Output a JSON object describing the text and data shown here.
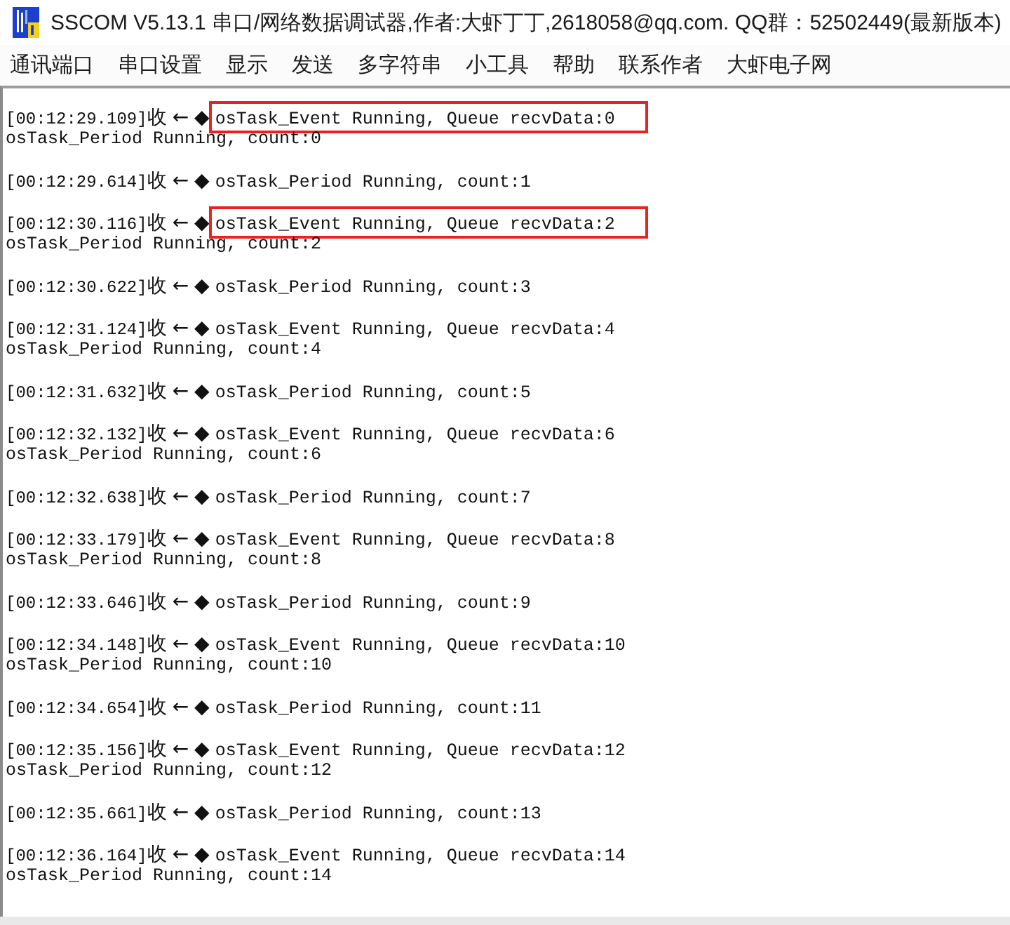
{
  "window": {
    "title": "SSCOM V5.13.1 串口/网络数据调试器,作者:大虾丁丁,2618058@qq.com. QQ群：52502449(最新版本)"
  },
  "menu": [
    "通讯端口",
    "串口设置",
    "显示",
    "发送",
    "多字符串",
    "小工具",
    "帮助",
    "联系作者",
    "大虾电子网"
  ],
  "receive_log": {
    "entries": [
      {
        "timestamp": "[00:12:29.109]",
        "marker": "收←◆",
        "lines": [
          "osTask_Event Running, Queue recvData:0",
          "osTask_Period Running, count:0"
        ],
        "highlighted": true
      },
      {
        "timestamp": "[00:12:29.614]",
        "marker": "收←◆",
        "lines": [
          "osTask_Period Running, count:1"
        ],
        "highlighted": false
      },
      {
        "timestamp": "[00:12:30.116]",
        "marker": "收←◆",
        "lines": [
          "osTask_Event Running, Queue recvData:2",
          "osTask_Period Running, count:2"
        ],
        "highlighted": true
      },
      {
        "timestamp": "[00:12:30.622]",
        "marker": "收←◆",
        "lines": [
          "osTask_Period Running, count:3"
        ],
        "highlighted": false
      },
      {
        "timestamp": "[00:12:31.124]",
        "marker": "收←◆",
        "lines": [
          "osTask_Event Running, Queue recvData:4",
          "osTask_Period Running, count:4"
        ],
        "highlighted": false
      },
      {
        "timestamp": "[00:12:31.632]",
        "marker": "收←◆",
        "lines": [
          "osTask_Period Running, count:5"
        ],
        "highlighted": false
      },
      {
        "timestamp": "[00:12:32.132]",
        "marker": "收←◆",
        "lines": [
          "osTask_Event Running, Queue recvData:6",
          "osTask_Period Running, count:6"
        ],
        "highlighted": false
      },
      {
        "timestamp": "[00:12:32.638]",
        "marker": "收←◆",
        "lines": [
          "osTask_Period Running, count:7"
        ],
        "highlighted": false
      },
      {
        "timestamp": "[00:12:33.179]",
        "marker": "收←◆",
        "lines": [
          "osTask_Event Running, Queue recvData:8",
          "osTask_Period Running, count:8"
        ],
        "highlighted": false
      },
      {
        "timestamp": "[00:12:33.646]",
        "marker": "收←◆",
        "lines": [
          "osTask_Period Running, count:9"
        ],
        "highlighted": false
      },
      {
        "timestamp": "[00:12:34.148]",
        "marker": "收←◆",
        "lines": [
          "osTask_Event Running, Queue recvData:10",
          "osTask_Period Running, count:10"
        ],
        "highlighted": false
      },
      {
        "timestamp": "[00:12:34.654]",
        "marker": "收←◆",
        "lines": [
          "osTask_Period Running, count:11"
        ],
        "highlighted": false
      },
      {
        "timestamp": "[00:12:35.156]",
        "marker": "收←◆",
        "lines": [
          "osTask_Event Running, Queue recvData:12",
          "osTask_Period Running, count:12"
        ],
        "highlighted": false
      },
      {
        "timestamp": "[00:12:35.661]",
        "marker": "收←◆",
        "lines": [
          "osTask_Period Running, count:13"
        ],
        "highlighted": false
      },
      {
        "timestamp": "[00:12:36.164]",
        "marker": "收←◆",
        "lines": [
          "osTask_Event Running, Queue recvData:14",
          "osTask_Period Running, count:14"
        ],
        "highlighted": false
      }
    ]
  }
}
